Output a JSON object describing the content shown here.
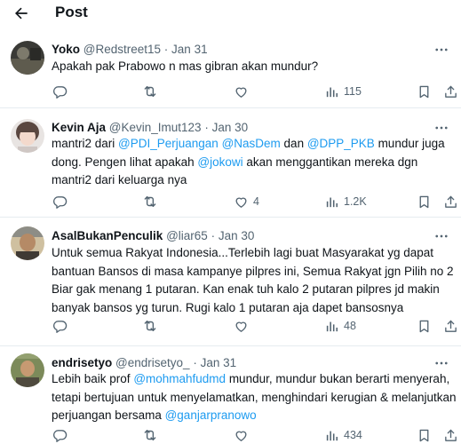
{
  "header": {
    "title": "Post"
  },
  "tweets": [
    {
      "name": "Yoko",
      "handle": "@Redstreet15",
      "date": "Jan 31",
      "text": [
        {
          "t": "Apakah pak Prabowo n mas gibran akan mundur?"
        }
      ],
      "replies": "",
      "reposts": "",
      "likes": "",
      "views": "115"
    },
    {
      "name": "Kevin Aja",
      "handle": "@Kevin_Imut123",
      "date": "Jan 30",
      "text": [
        {
          "t": "mantri2 dari "
        },
        {
          "t": "@PDI_Perjuangan",
          "m": true
        },
        {
          "t": " "
        },
        {
          "t": "@NasDem",
          "m": true
        },
        {
          "t": " dan "
        },
        {
          "t": "@DPP_PKB",
          "m": true
        },
        {
          "t": " mundur juga dong. Pengen lihat apakah "
        },
        {
          "t": "@jokowi",
          "m": true
        },
        {
          "t": " akan menggantikan mereka dgn mantri2 dari keluarga nya"
        }
      ],
      "replies": "",
      "reposts": "",
      "likes": "4",
      "views": "1.2K"
    },
    {
      "name": "AsalBukanPenculik",
      "handle": "@liar65",
      "date": "Jan 30",
      "text": [
        {
          "t": "Untuk semua Rakyat Indonesia...Terlebih lagi buat Masyarakat yg dapat bantuan Bansos di masa kampanye pilpres ini, Semua Rakyat  jgn Pilih no 2 Biar gak menang 1 putaran. Kan enak tuh kalo 2 putaran pilpres jd makin banyak bansos yg turun. Rugi kalo 1 putaran aja dapet bansosnya"
        }
      ],
      "replies": "",
      "reposts": "",
      "likes": "",
      "views": "48"
    },
    {
      "name": "endrisetyo",
      "handle": "@endrisetyo_",
      "date": "Jan 31",
      "text": [
        {
          "t": "Lebih baik prof "
        },
        {
          "t": "@mohmahfudmd",
          "m": true
        },
        {
          "t": " mundur, mundur bukan berarti menyerah, tetapi bertujuan untuk menyelamatkan, menghindari kerugian & melanjutkan perjuangan bersama "
        },
        {
          "t": "@ganjarpranowo",
          "m": true
        }
      ],
      "replies": "",
      "reposts": "",
      "likes": "",
      "views": "434"
    }
  ],
  "colors": {
    "accent": "#1d9bf0",
    "muted": "#536471",
    "text": "#0f1419",
    "border": "#e6ecf0"
  },
  "icons": [
    "back-arrow-icon",
    "more-icon",
    "reply-icon",
    "repost-icon",
    "like-icon",
    "views-icon",
    "bookmark-icon",
    "share-icon"
  ]
}
